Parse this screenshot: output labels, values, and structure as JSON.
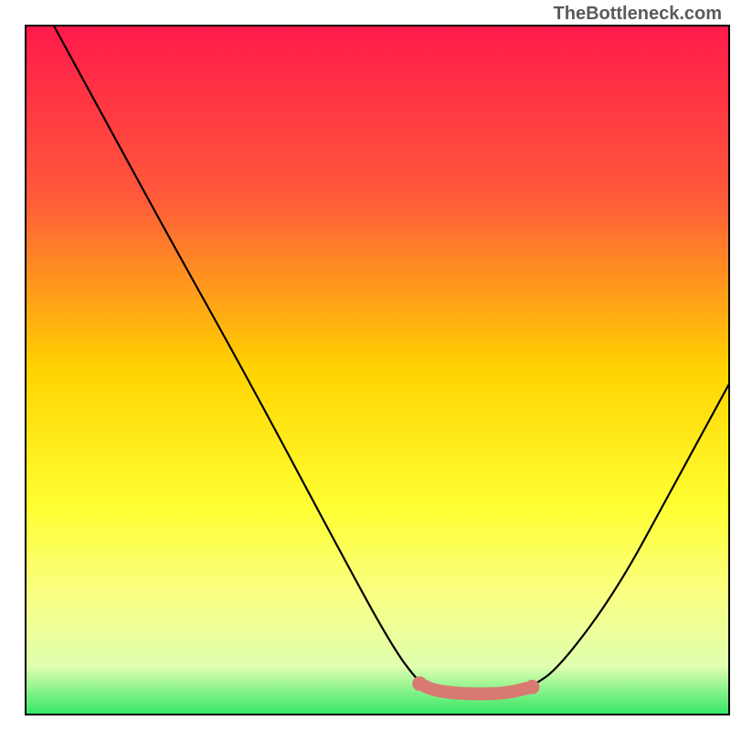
{
  "attribution": "TheBottleneck.com",
  "chart_data": {
    "type": "line",
    "title": "",
    "xlabel": "",
    "ylabel": "",
    "xlim": [
      0,
      100
    ],
    "ylim": [
      0,
      100
    ],
    "gradient_stops": [
      {
        "offset": 0,
        "color": "#ff1a4a"
      },
      {
        "offset": 25,
        "color": "#ff5a3a"
      },
      {
        "offset": 50,
        "color": "#ffd400"
      },
      {
        "offset": 70,
        "color": "#ffff33"
      },
      {
        "offset": 82,
        "color": "#faff80"
      },
      {
        "offset": 93,
        "color": "#e0ffb0"
      },
      {
        "offset": 100,
        "color": "#33e666"
      }
    ],
    "series": [
      {
        "name": "bottleneck-curve",
        "color": "#000000",
        "points": [
          {
            "x": 4,
            "y": 100
          },
          {
            "x": 12,
            "y": 85
          },
          {
            "x": 20,
            "y": 70
          },
          {
            "x": 32,
            "y": 48
          },
          {
            "x": 44,
            "y": 25
          },
          {
            "x": 52,
            "y": 10
          },
          {
            "x": 56,
            "y": 4.5
          },
          {
            "x": 58,
            "y": 3.5
          },
          {
            "x": 62,
            "y": 3
          },
          {
            "x": 68,
            "y": 3
          },
          {
            "x": 72,
            "y": 4
          },
          {
            "x": 76,
            "y": 7
          },
          {
            "x": 84,
            "y": 18
          },
          {
            "x": 92,
            "y": 33
          },
          {
            "x": 100,
            "y": 48
          }
        ]
      },
      {
        "name": "highlight-band",
        "color": "#d97a72",
        "points": [
          {
            "x": 56,
            "y": 4.5
          },
          {
            "x": 58,
            "y": 3.5
          },
          {
            "x": 62,
            "y": 3
          },
          {
            "x": 68,
            "y": 3
          },
          {
            "x": 72,
            "y": 4
          }
        ]
      }
    ],
    "highlight_dots": [
      {
        "x": 56,
        "y": 4.5
      },
      {
        "x": 72,
        "y": 4
      }
    ]
  }
}
